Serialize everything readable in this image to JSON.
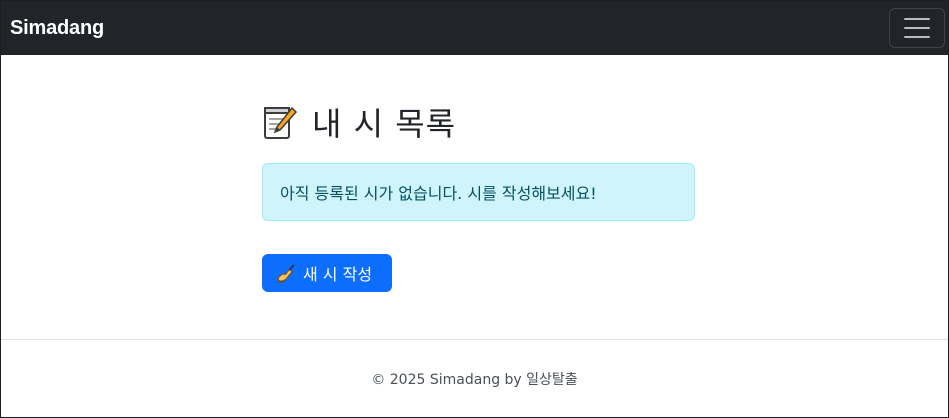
{
  "navbar": {
    "brand": "Simadang",
    "toggle_icon": "hamburger-menu-icon"
  },
  "main": {
    "title_icon": "memo-icon",
    "title": "내 시 목록",
    "empty_message": "아직 등록된 시가 없습니다. 시를 작성해보세요!",
    "new_button_icon": "writing-hand-icon",
    "new_button_label": "새 시 작성"
  },
  "footer": {
    "text": "© 2025 Simadang by 일상탈출"
  },
  "colors": {
    "navbar_bg": "#212529",
    "primary": "#0d6efd",
    "alert_bg": "#cff4fc",
    "alert_border": "#9eeaf9",
    "alert_text": "#055160"
  }
}
